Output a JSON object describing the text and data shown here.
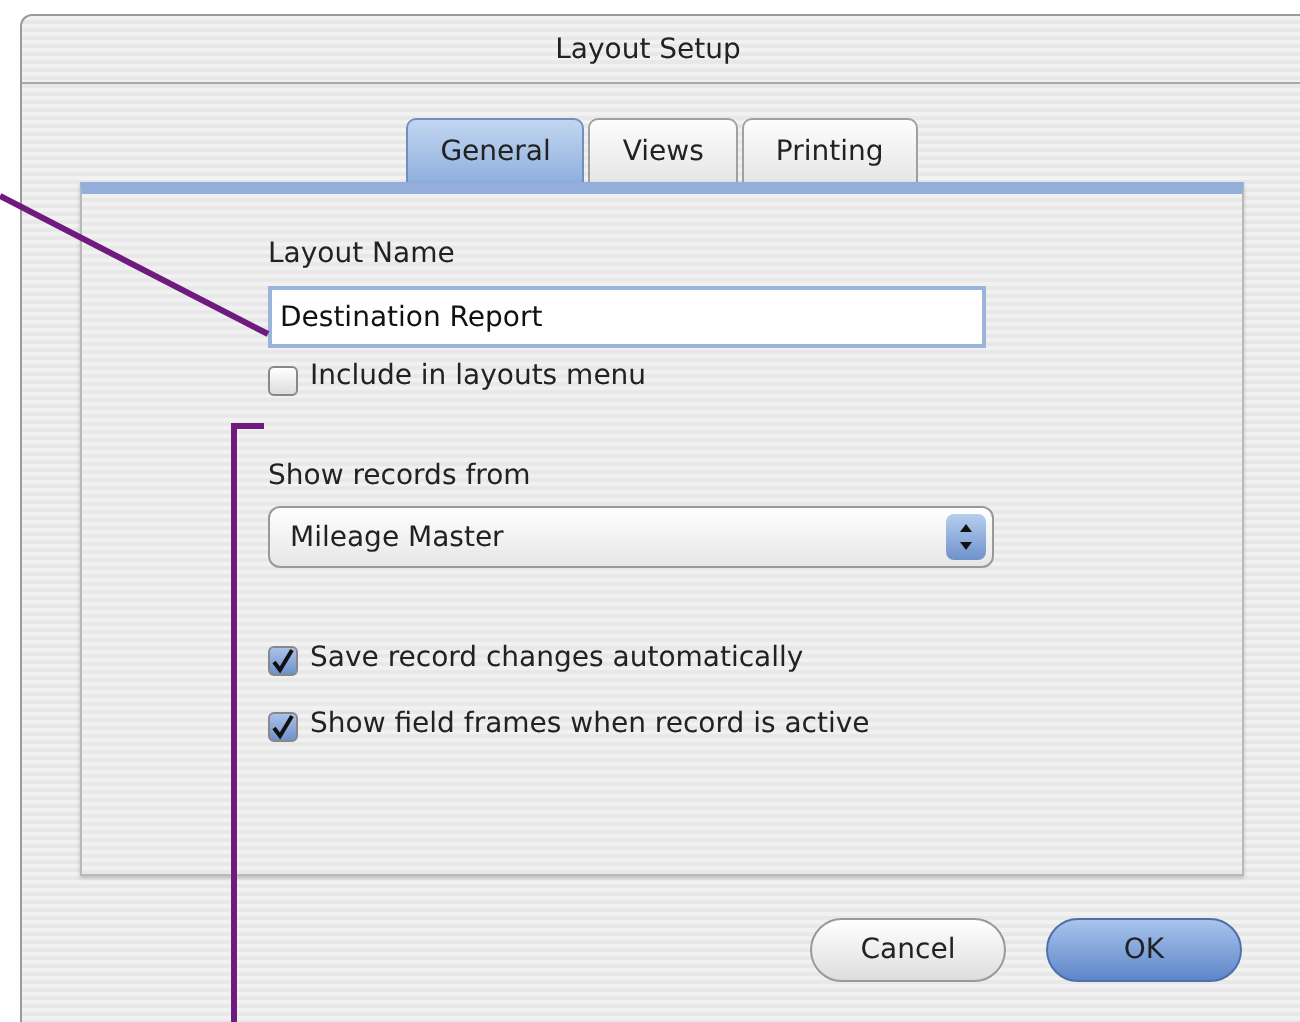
{
  "window": {
    "title": "Layout Setup"
  },
  "tabs": [
    {
      "label": "General",
      "selected": true
    },
    {
      "label": "Views",
      "selected": false
    },
    {
      "label": "Printing",
      "selected": false
    }
  ],
  "layout_name": {
    "label": "Layout Name",
    "value": "Destination Report"
  },
  "include_in_menu": {
    "label": "Include in layouts menu",
    "checked": false
  },
  "show_records": {
    "label": "Show records from",
    "value": "Mileage Master"
  },
  "options": [
    {
      "label": "Save record changes automatically",
      "checked": true
    },
    {
      "label": "Show field frames when record is active",
      "checked": true
    }
  ],
  "buttons": [
    {
      "label": "Cancel",
      "default": false
    },
    {
      "label": "OK",
      "default": true
    }
  ]
}
